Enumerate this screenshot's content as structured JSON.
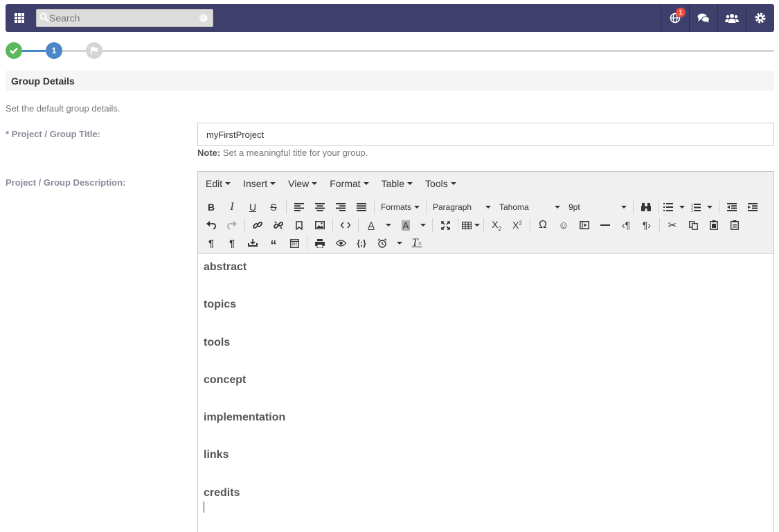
{
  "search": {
    "placeholder": "Search"
  },
  "nav": {
    "notifications_count": "1"
  },
  "stepper": {
    "current_step": "1"
  },
  "section": {
    "title": "Group Details",
    "description": "Set the default group details."
  },
  "fields": {
    "title_label": "* Project / Group Title:",
    "title_value": "myFirstProject",
    "note_bold": "Note:",
    "note_text": " Set a meaningful title for your group.",
    "description_label": "Project / Group Description:"
  },
  "editor": {
    "menus": [
      "Edit",
      "Insert",
      "View",
      "Format",
      "Table",
      "Tools"
    ],
    "formats_label": "Formats",
    "block_label": "Paragraph",
    "font_label": "Tahoma",
    "size_label": "9pt",
    "content": [
      "abstract",
      "topics",
      "tools",
      "concept",
      "implementation",
      "links",
      "credits"
    ]
  },
  "colors": {
    "navbar": "#3e3f6b",
    "step_done": "#5cb85c",
    "step_current": "#4b86c6",
    "badge": "#e74c3c"
  }
}
